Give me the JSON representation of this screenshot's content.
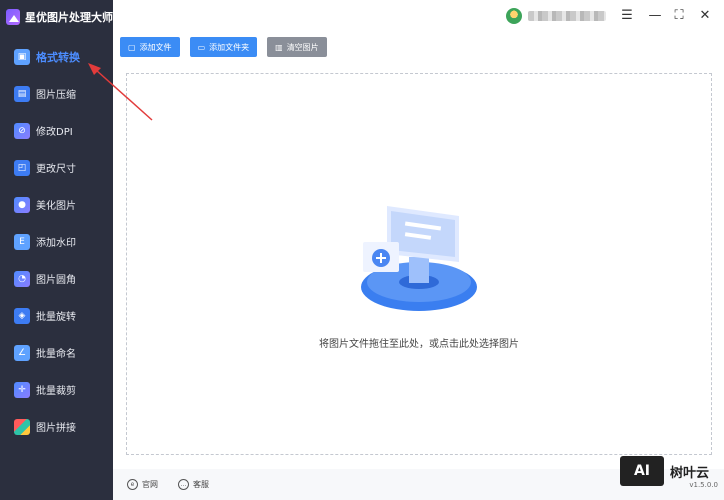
{
  "app": {
    "title": "星优图片处理大师"
  },
  "sidebar": {
    "items": [
      {
        "label": "格式转换",
        "icon": "format-convert-icon",
        "active": true
      },
      {
        "label": "图片压缩",
        "icon": "compress-icon"
      },
      {
        "label": "修改DPI",
        "icon": "dpi-icon"
      },
      {
        "label": "更改尺寸",
        "icon": "resize-icon"
      },
      {
        "label": "美化图片",
        "icon": "beautify-icon"
      },
      {
        "label": "添加水印",
        "icon": "watermark-icon"
      },
      {
        "label": "图片圆角",
        "icon": "round-corner-icon"
      },
      {
        "label": "批量旋转",
        "icon": "rotate-icon"
      },
      {
        "label": "批量命名",
        "icon": "rename-icon"
      },
      {
        "label": "批量裁剪",
        "icon": "crop-icon"
      },
      {
        "label": "图片拼接",
        "icon": "stitch-icon"
      }
    ]
  },
  "toolbar": {
    "add_file": "添加文件",
    "add_folder": "添加文件夹",
    "clear": "清空图片"
  },
  "dropzone": {
    "hint": "将图片文件拖住至此处，或点击此处选择图片"
  },
  "footer": {
    "website": "官网",
    "service": "客服",
    "version": "v1.5.0.0"
  },
  "watermark": {
    "logo": "AI",
    "text": "树叶云"
  },
  "colors": {
    "sidebar_bg": "#2b2f3e",
    "accent": "#3b8cf5",
    "active_text": "#4c8dff"
  }
}
